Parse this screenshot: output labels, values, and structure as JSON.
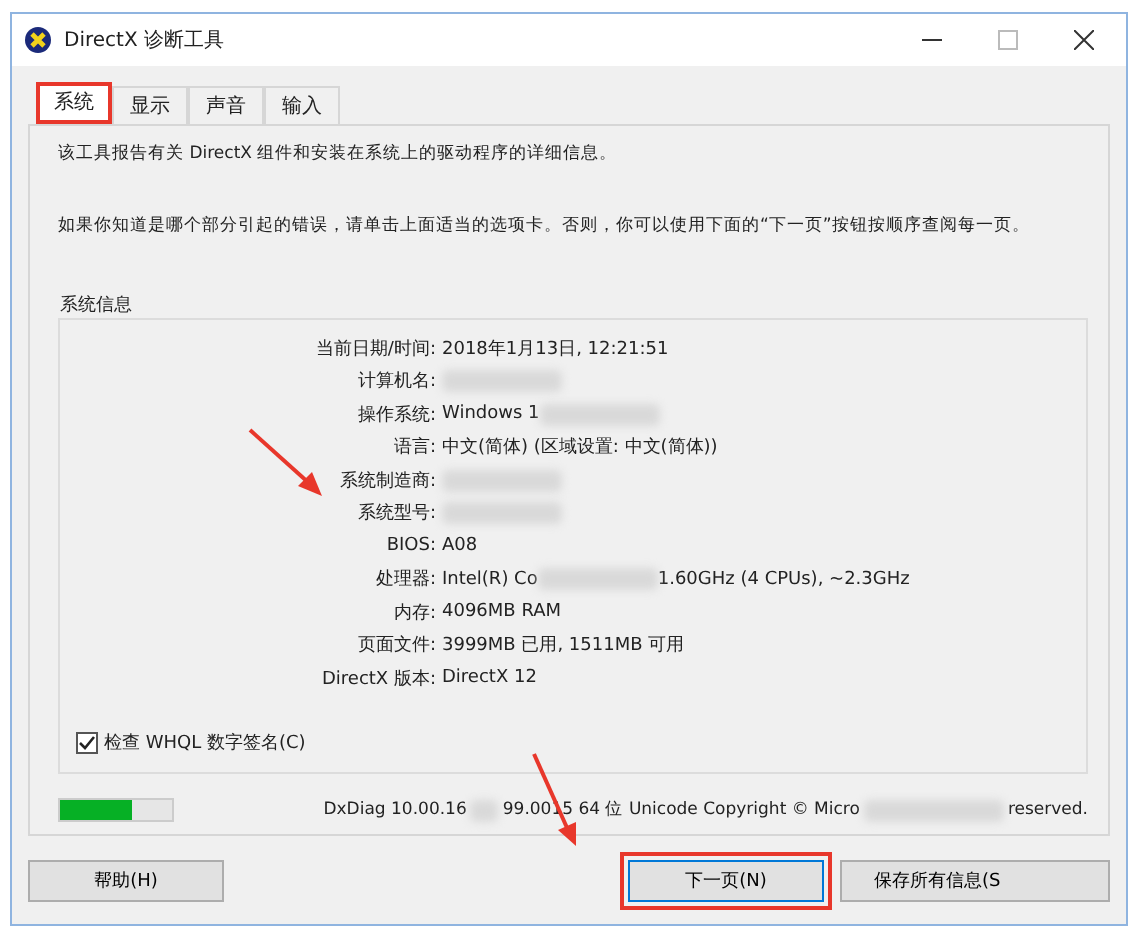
{
  "window": {
    "title": "DirectX 诊断工具"
  },
  "tabs": [
    {
      "label": "系统",
      "selected": true,
      "highlighted": true
    },
    {
      "label": "显示",
      "selected": false,
      "highlighted": false
    },
    {
      "label": "声音",
      "selected": false,
      "highlighted": false
    },
    {
      "label": "输入",
      "selected": false,
      "highlighted": false
    }
  ],
  "intro": [
    "该工具报告有关 DirectX 组件和安装在系统上的驱动程序的详细信息。",
    "如果你知道是哪个部分引起的错误，请单击上面适当的选项卡。否则，你可以使用下面的“下一页”按钮按顺序查阅每一页。"
  ],
  "system_info": {
    "title": "系统信息",
    "rows": [
      {
        "label": "当前日期/时间:",
        "value": "2018年1月13日, 12:21:51"
      },
      {
        "label": "计算机名:",
        "value": "",
        "blurred": true
      },
      {
        "label": "操作系统:",
        "value": "Windows 1",
        "blurred": true
      },
      {
        "label": "语言:",
        "value": "中文(简体) (区域设置: 中文(简体))"
      },
      {
        "label": "系统制造商:",
        "value": "",
        "blurred": true
      },
      {
        "label": "系统型号:",
        "value": "",
        "blurred": true
      },
      {
        "label": "BIOS:",
        "value": "A08"
      },
      {
        "label": "处理器:",
        "value": "Intel(R) Co",
        "blurred": true,
        "value_after": "1.60GHz (4 CPUs), ~2.3GHz"
      },
      {
        "label": "内存:",
        "value": "4096MB RAM"
      },
      {
        "label": "页面文件:",
        "value": "3999MB 已用, 1511MB 可用"
      },
      {
        "label": "DirectX 版本:",
        "value": "DirectX 12"
      }
    ]
  },
  "whql_check": {
    "label": "检查 WHQL 数字签名(C)",
    "checked": true
  },
  "progress": {
    "level": 0.65
  },
  "footer_text": {
    "before": "DxDiag 10.00.16",
    "after": "99.0015 64 位 Unicode  Copyright © Micro",
    "end": "reserved."
  },
  "buttons": [
    {
      "label": "帮助(H)",
      "highlighted": false
    },
    {
      "label": "下一页(N)",
      "highlighted": true
    },
    {
      "label": "保存所有信息(S",
      "highlighted": false
    }
  ]
}
